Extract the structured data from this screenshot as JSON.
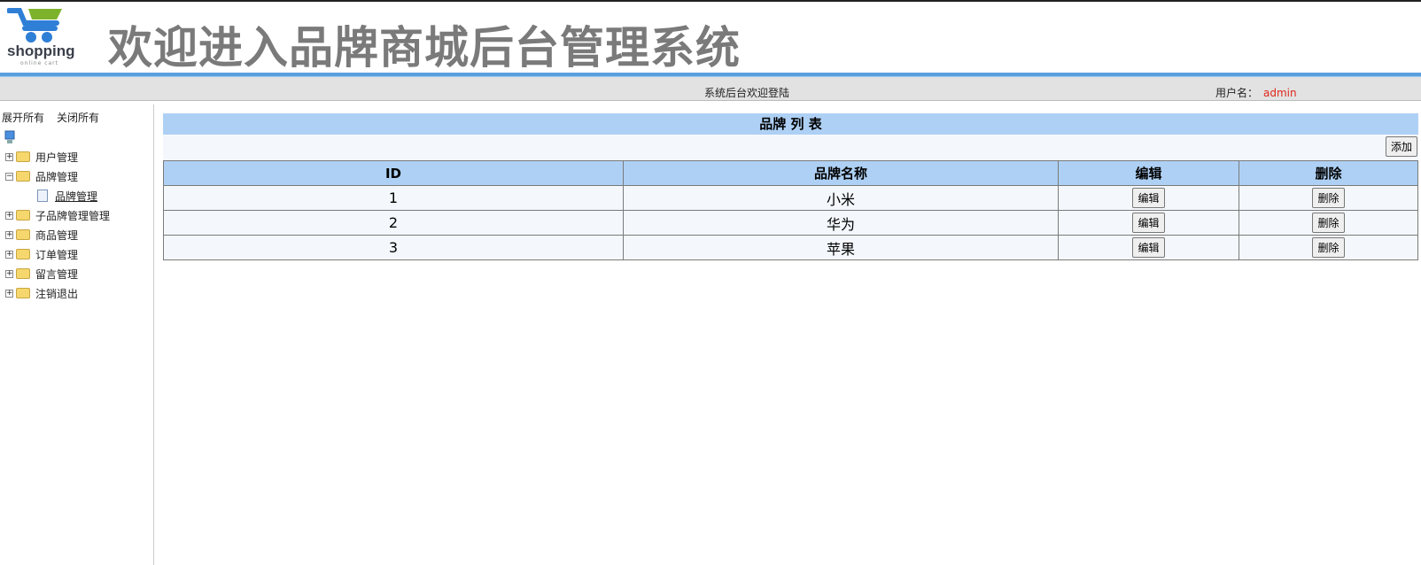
{
  "header": {
    "logo_text": "shopping",
    "logo_sub": "online cart",
    "title": "欢迎进入品牌商城后台管理系统"
  },
  "bar": {
    "welcome": "系统后台欢迎登陆",
    "user_label": "用户名：",
    "user_name": "admin"
  },
  "sidebar": {
    "expand_all": "展开所有",
    "collapse_all": "关闭所有",
    "items": [
      {
        "label": "用户管理",
        "sign": "+"
      },
      {
        "label": "品牌管理",
        "sign": "−",
        "children": [
          {
            "label": "品牌管理"
          }
        ]
      },
      {
        "label": "子品牌管理管理",
        "sign": "+"
      },
      {
        "label": "商品管理",
        "sign": "+"
      },
      {
        "label": "订单管理",
        "sign": "+"
      },
      {
        "label": "留言管理",
        "sign": "+"
      },
      {
        "label": "注销退出",
        "sign": "+"
      }
    ]
  },
  "main": {
    "caption": "品牌 列 表",
    "add": "添加",
    "columns": [
      "ID",
      "品牌名称",
      "编辑",
      "删除"
    ],
    "rows": [
      {
        "id": "1",
        "name": "小米",
        "edit": "编辑",
        "del": "删除"
      },
      {
        "id": "2",
        "name": "华为",
        "edit": "编辑",
        "del": "删除"
      },
      {
        "id": "3",
        "name": "苹果",
        "edit": "编辑",
        "del": "删除"
      }
    ]
  }
}
